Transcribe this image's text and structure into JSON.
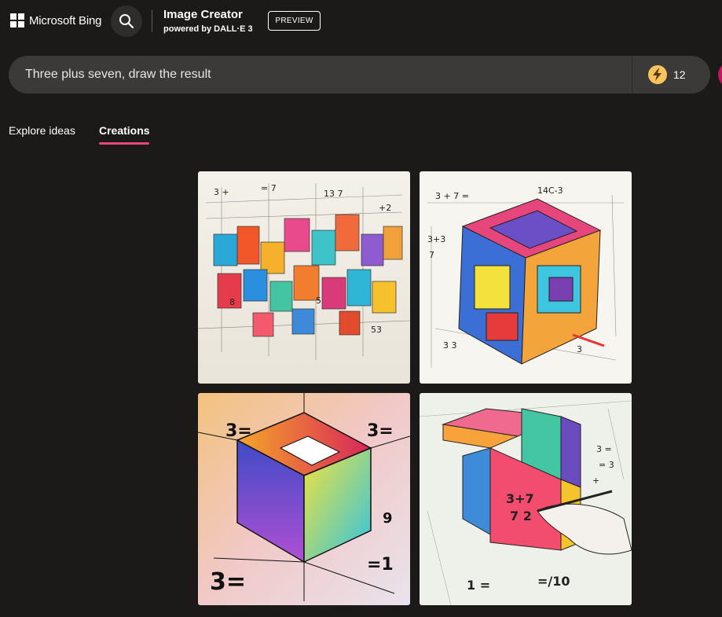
{
  "header": {
    "logo_text": "Microsoft Bing",
    "title": "Image Creator",
    "subtitle": "powered by DALL·E 3",
    "preview_label": "PREVIEW",
    "search_icon": "search-icon"
  },
  "prompt": {
    "value": "Three plus seven, draw the result",
    "boost_count": "12",
    "boost_icon": "lightning-bolt-icon"
  },
  "tabs": [
    {
      "label": "Explore ideas",
      "active": false
    },
    {
      "label": "Creations",
      "active": true
    }
  ],
  "colors": {
    "background": "#1b1a19",
    "prompt_bar": "#3b3a39",
    "tab_accent": "#e8467c",
    "boost": "#f7c35a"
  }
}
